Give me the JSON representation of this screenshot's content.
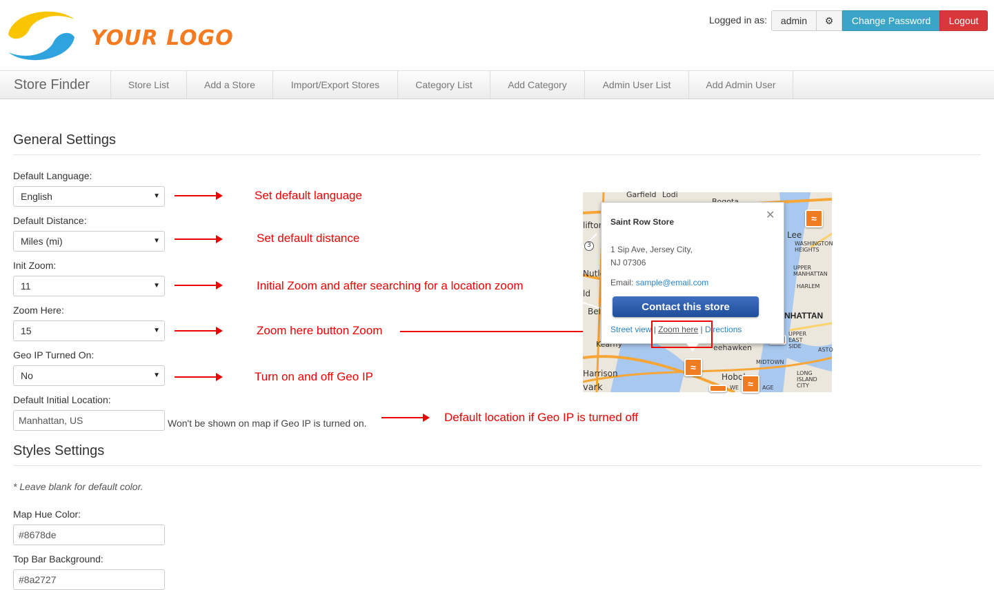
{
  "header": {
    "logo_text": "YOUR LOGO",
    "logged_in_label": "Logged in as:",
    "username": "admin",
    "change_password": "Change Password",
    "logout": "Logout"
  },
  "nav": {
    "brand": "Store Finder",
    "items": [
      "Store List",
      "Add a Store",
      "Import/Export Stores",
      "Category List",
      "Add Category",
      "Admin User List",
      "Add Admin User"
    ]
  },
  "general": {
    "title": "General Settings",
    "fields": [
      {
        "label": "Default Language:",
        "value": "English"
      },
      {
        "label": "Default Distance:",
        "value": "Miles (mi)"
      },
      {
        "label": "Init Zoom:",
        "value": "11"
      },
      {
        "label": "Zoom Here:",
        "value": "15"
      },
      {
        "label": "Geo IP Turned On:",
        "value": "No"
      },
      {
        "label": "Default Initial Location:",
        "value": "Manhattan, US"
      }
    ],
    "location_help": "Won't be shown on map if Geo IP is turned on."
  },
  "annotations": [
    "Set default language",
    "Set default distance",
    "Initial Zoom and after searching for a location zoom",
    "Zoom here button Zoom",
    "Turn on and off Geo IP",
    "Default location if Geo IP is turned off"
  ],
  "styles": {
    "title": "Styles Settings",
    "note": "* Leave blank for default color.",
    "fields": [
      {
        "label": "Map Hue Color:",
        "value": "#8678de"
      },
      {
        "label": "Top Bar Background:",
        "value": "#8a2727"
      }
    ]
  },
  "map": {
    "popup_title": "Saint Row Store",
    "address_line1": "1 Sip Ave, Jersey City,",
    "address_line2": "NJ 07306",
    "email_label": "Email:",
    "email": "sample@email.com",
    "contact_button": "Contact this store",
    "link_street": "Street view",
    "link_zoom": "Zoom here",
    "link_directions": "Directions",
    "labels": [
      "Garfield",
      "Lodi",
      "Bogota",
      "lifton",
      "Lee",
      "WASHINGTON HEIGHTS",
      "UPPER MANHATTAN",
      "HARLEM",
      "Nutle",
      "ld",
      "Bell",
      "NHATTAN",
      "UPPER EAST SIDE",
      "Kearny",
      "eehawken",
      "MIDTOWN",
      "Harrison",
      "Hoboken",
      "LONG ISLAND CITY",
      "vark",
      "ASTO",
      "3",
      "WE",
      "AGE"
    ]
  },
  "colors": {
    "accent_blue": "#3aa5c9",
    "danger_red": "#d9383a",
    "annotation_red": "#ee0000",
    "logo_orange": "#f47b20"
  }
}
